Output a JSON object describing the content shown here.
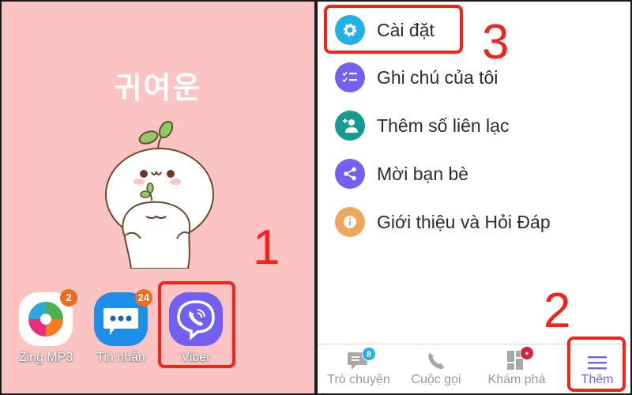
{
  "home_screen": {
    "wallpaper_text": "귀여운",
    "apps": [
      {
        "label": "Zing MP3",
        "badge": "2",
        "icon": "zing-mp3-icon"
      },
      {
        "label": "Tin nhắn",
        "badge": "24",
        "icon": "messages-icon"
      },
      {
        "label": "Viber",
        "badge": null,
        "icon": "viber-icon"
      }
    ]
  },
  "annotations": {
    "step1": "1",
    "step2": "2",
    "step3": "3"
  },
  "more_menu": {
    "items": [
      {
        "label": "Cài đặt",
        "icon": "gear-icon",
        "color": "#22b0e6"
      },
      {
        "label": "Ghi chú của tôi",
        "icon": "checklist-icon",
        "color": "#7360f2"
      },
      {
        "label": "Thêm số liên lạc",
        "icon": "add-contact-icon",
        "color": "#159c8f"
      },
      {
        "label": "Mời bạn bè",
        "icon": "share-icon",
        "color": "#7360f2"
      },
      {
        "label": "Giới thiệu và Hỏi Đáp",
        "icon": "info-icon",
        "color": "#f0a65a"
      }
    ]
  },
  "bottom_nav": {
    "tabs": [
      {
        "label": "Trò chuyện",
        "icon": "chat-icon",
        "badge": "8"
      },
      {
        "label": "Cuộc gọi",
        "icon": "phone-icon"
      },
      {
        "label": "Khám phá",
        "icon": "explore-icon",
        "badge": "•"
      },
      {
        "label": "Thêm",
        "icon": "hamburger-menu-icon",
        "active": true
      }
    ]
  },
  "colors": {
    "viber_purple": "#7360f2",
    "highlight_red": "#f2231a",
    "wallpaper_pink": "#fbc4c3"
  }
}
